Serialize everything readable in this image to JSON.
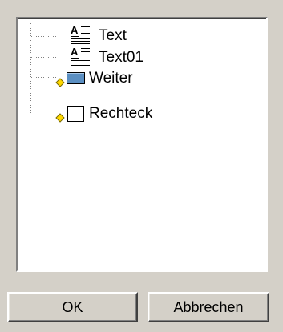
{
  "tree": {
    "items": [
      {
        "label": "Text",
        "icon": "text-field-icon"
      },
      {
        "label": "Text01",
        "icon": "text-field-icon"
      },
      {
        "label": "Weiter",
        "icon": "button-control-icon"
      },
      {
        "label": "Rechteck",
        "icon": "rectangle-icon"
      }
    ]
  },
  "buttons": {
    "ok_label": "OK",
    "cancel_label": "Abbrechen"
  },
  "colors": {
    "dialog_background": "#d4d0c8",
    "tree_background": "#ffffff",
    "connector_line": "#808080",
    "marker_fill": "#ffd800",
    "button_icon_fill": "#5b8fc2"
  }
}
